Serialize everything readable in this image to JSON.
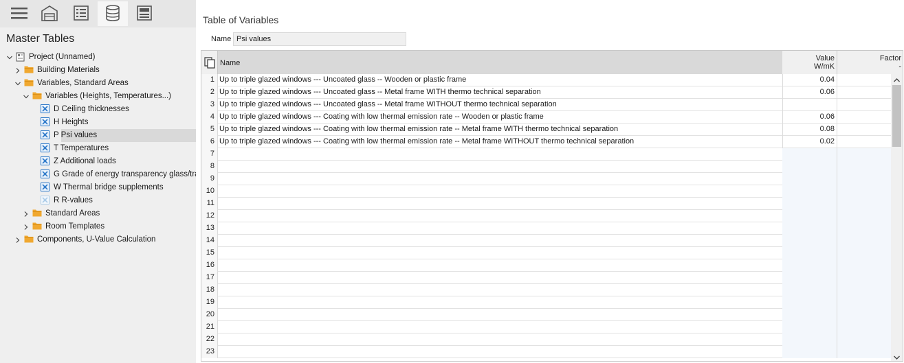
{
  "toolbar": {
    "buttons": [
      {
        "icon": "hamburger-menu-icon",
        "active": false
      },
      {
        "icon": "building-icon",
        "active": false
      },
      {
        "icon": "list-icon",
        "active": false
      },
      {
        "icon": "database-icon",
        "active": true
      },
      {
        "icon": "form-icon",
        "active": false
      }
    ]
  },
  "left_panel": {
    "title": "Master Tables",
    "tree": [
      {
        "label": "Project (Unnamed)",
        "icon": "project-icon",
        "expanded": true
      },
      {
        "label": "Building Materials",
        "icon": "folder-icon",
        "expanded": false
      },
      {
        "label": "Variables, Standard Areas",
        "icon": "folder-icon",
        "expanded": true
      },
      {
        "label": "Variables (Heights, Temperatures...)",
        "icon": "folder-icon",
        "expanded": true
      },
      {
        "label": "D Ceiling thicknesses",
        "icon": "variable-table-icon"
      },
      {
        "label": "H Heights",
        "icon": "variable-table-icon"
      },
      {
        "label": "P Psi values",
        "icon": "variable-table-icon",
        "selected": true
      },
      {
        "label": "T Temperatures",
        "icon": "variable-table-icon"
      },
      {
        "label": "Z Additional loads",
        "icon": "variable-table-icon"
      },
      {
        "label": "G Grade of energy transparency glass/tra",
        "icon": "variable-table-icon"
      },
      {
        "label": "W Thermal bridge supplements",
        "icon": "variable-table-icon"
      },
      {
        "label": "R R-values",
        "icon": "variable-table-icon-disabled"
      },
      {
        "label": "Standard Areas",
        "icon": "folder-icon",
        "expanded": false
      },
      {
        "label": "Room Templates",
        "icon": "folder-icon",
        "expanded": false
      },
      {
        "label": "Components, U-Value Calculation",
        "icon": "folder-icon",
        "expanded": false
      }
    ]
  },
  "main": {
    "section_title": "Table of Variables",
    "name_label": "Name",
    "name_value": "Psi values",
    "table": {
      "columns": {
        "name": "Name",
        "value": "Value",
        "value_unit": "W/mK",
        "factor": "Factor",
        "factor_unit": "-"
      },
      "rows": [
        {
          "num": "1",
          "name": "Up to triple glazed windows --- Uncoated glass -- Wooden or plastic frame",
          "value": "0.04",
          "factor": ""
        },
        {
          "num": "2",
          "name": "Up to triple glazed windows --- Uncoated glass -- Metal frame WITH thermo technical separation",
          "value": "0.06",
          "factor": ""
        },
        {
          "num": "3",
          "name": "Up to triple glazed windows --- Uncoated glass -- Metal frame WITHOUT thermo technical separation",
          "value": "",
          "factor": ""
        },
        {
          "num": "4",
          "name": "Up to triple glazed windows --- Coating with low thermal emission rate -- Wooden or plastic frame",
          "value": "0.06",
          "factor": ""
        },
        {
          "num": "5",
          "name": "Up to triple glazed windows --- Coating with low thermal emission rate -- Metal frame WITH thermo technical separation",
          "value": "0.08",
          "factor": ""
        },
        {
          "num": "6",
          "name": "Up to triple glazed windows --- Coating with low thermal emission rate -- Metal frame WITHOUT thermo technical separation",
          "value": "0.02",
          "factor": ""
        },
        {
          "num": "7",
          "name": "",
          "value": "",
          "factor": ""
        },
        {
          "num": "8",
          "name": "",
          "value": "",
          "factor": ""
        },
        {
          "num": "9",
          "name": "",
          "value": "",
          "factor": ""
        },
        {
          "num": "10",
          "name": "",
          "value": "",
          "factor": ""
        },
        {
          "num": "11",
          "name": "",
          "value": "",
          "factor": ""
        },
        {
          "num": "12",
          "name": "",
          "value": "",
          "factor": ""
        },
        {
          "num": "13",
          "name": "",
          "value": "",
          "factor": ""
        },
        {
          "num": "14",
          "name": "",
          "value": "",
          "factor": ""
        },
        {
          "num": "15",
          "name": "",
          "value": "",
          "factor": ""
        },
        {
          "num": "16",
          "name": "",
          "value": "",
          "factor": ""
        },
        {
          "num": "17",
          "name": "",
          "value": "",
          "factor": ""
        },
        {
          "num": "18",
          "name": "",
          "value": "",
          "factor": ""
        },
        {
          "num": "19",
          "name": "",
          "value": "",
          "factor": ""
        },
        {
          "num": "20",
          "name": "",
          "value": "",
          "factor": ""
        },
        {
          "num": "21",
          "name": "",
          "value": "",
          "factor": ""
        },
        {
          "num": "22",
          "name": "",
          "value": "",
          "factor": ""
        },
        {
          "num": "23",
          "name": "",
          "value": "",
          "factor": ""
        }
      ]
    }
  },
  "colors": {
    "folder": "#f0a830",
    "variable_icon": "#2b78c9",
    "variable_icon_disabled": "#a9cbe8",
    "selected_row": "#d9d9d9",
    "name_header": "#d9d9d9"
  }
}
